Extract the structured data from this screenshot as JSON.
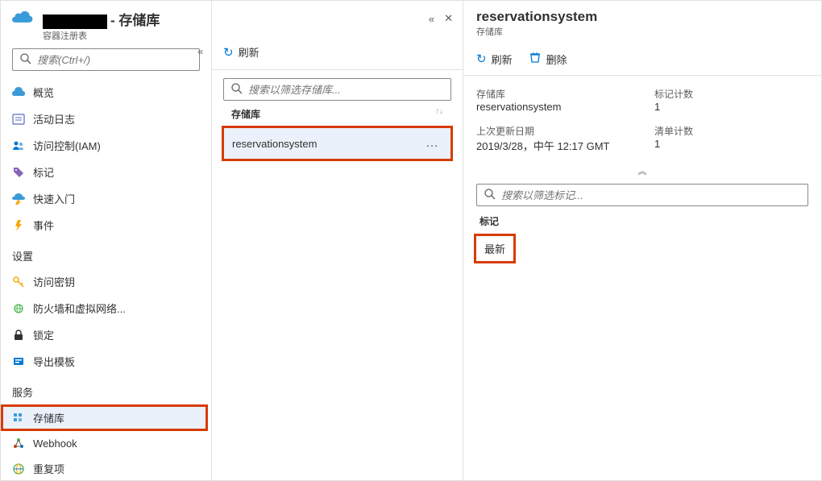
{
  "sidebar": {
    "title_suffix": "- 存储库",
    "subtitle": "容器注册表",
    "search_placeholder": "搜索(Ctrl+/)",
    "items": [
      {
        "icon": "overview",
        "label": "概览"
      },
      {
        "icon": "activity",
        "label": "活动日志"
      },
      {
        "icon": "iam",
        "label": "访问控制(IAM)"
      },
      {
        "icon": "tag",
        "label": "标记"
      },
      {
        "icon": "quickstart",
        "label": "快速入门"
      },
      {
        "icon": "event",
        "label": "事件"
      }
    ],
    "settings_label": "设置",
    "settings_items": [
      {
        "icon": "key",
        "label": "访问密钥"
      },
      {
        "icon": "firewall",
        "label": "防火墙和虚拟网络..."
      },
      {
        "icon": "lock",
        "label": "锁定"
      },
      {
        "icon": "export",
        "label": "导出模板"
      }
    ],
    "services_label": "服务",
    "services_items": [
      {
        "icon": "repo",
        "label": "存储库",
        "selected": true,
        "highlighted": true
      },
      {
        "icon": "webhook",
        "label": "Webhook"
      },
      {
        "icon": "replication",
        "label": "重复项"
      }
    ]
  },
  "mid": {
    "refresh_label": "刷新",
    "search_placeholder": "搜索以筛选存储库...",
    "list_header": "存储库",
    "rows": [
      {
        "name": "reservationsystem",
        "highlighted": true
      }
    ]
  },
  "right": {
    "title": "reservationsystem",
    "subtitle": "存储库",
    "refresh_label": "刷新",
    "delete_label": "删除",
    "fields": {
      "repo_label": "存储库",
      "repo_value": "reservationsystem",
      "tag_count_label": "标记计数",
      "tag_count_value": "1",
      "updated_label": "上次更新日期",
      "updated_value": "2019/3/28，中午 12:17 GMT",
      "manifest_count_label": "清单计数",
      "manifest_count_value": "1"
    },
    "tag_search_placeholder": "搜索以筛选标记...",
    "tags_heading": "标记",
    "tags": [
      {
        "name": "最新",
        "highlighted": true
      }
    ]
  }
}
